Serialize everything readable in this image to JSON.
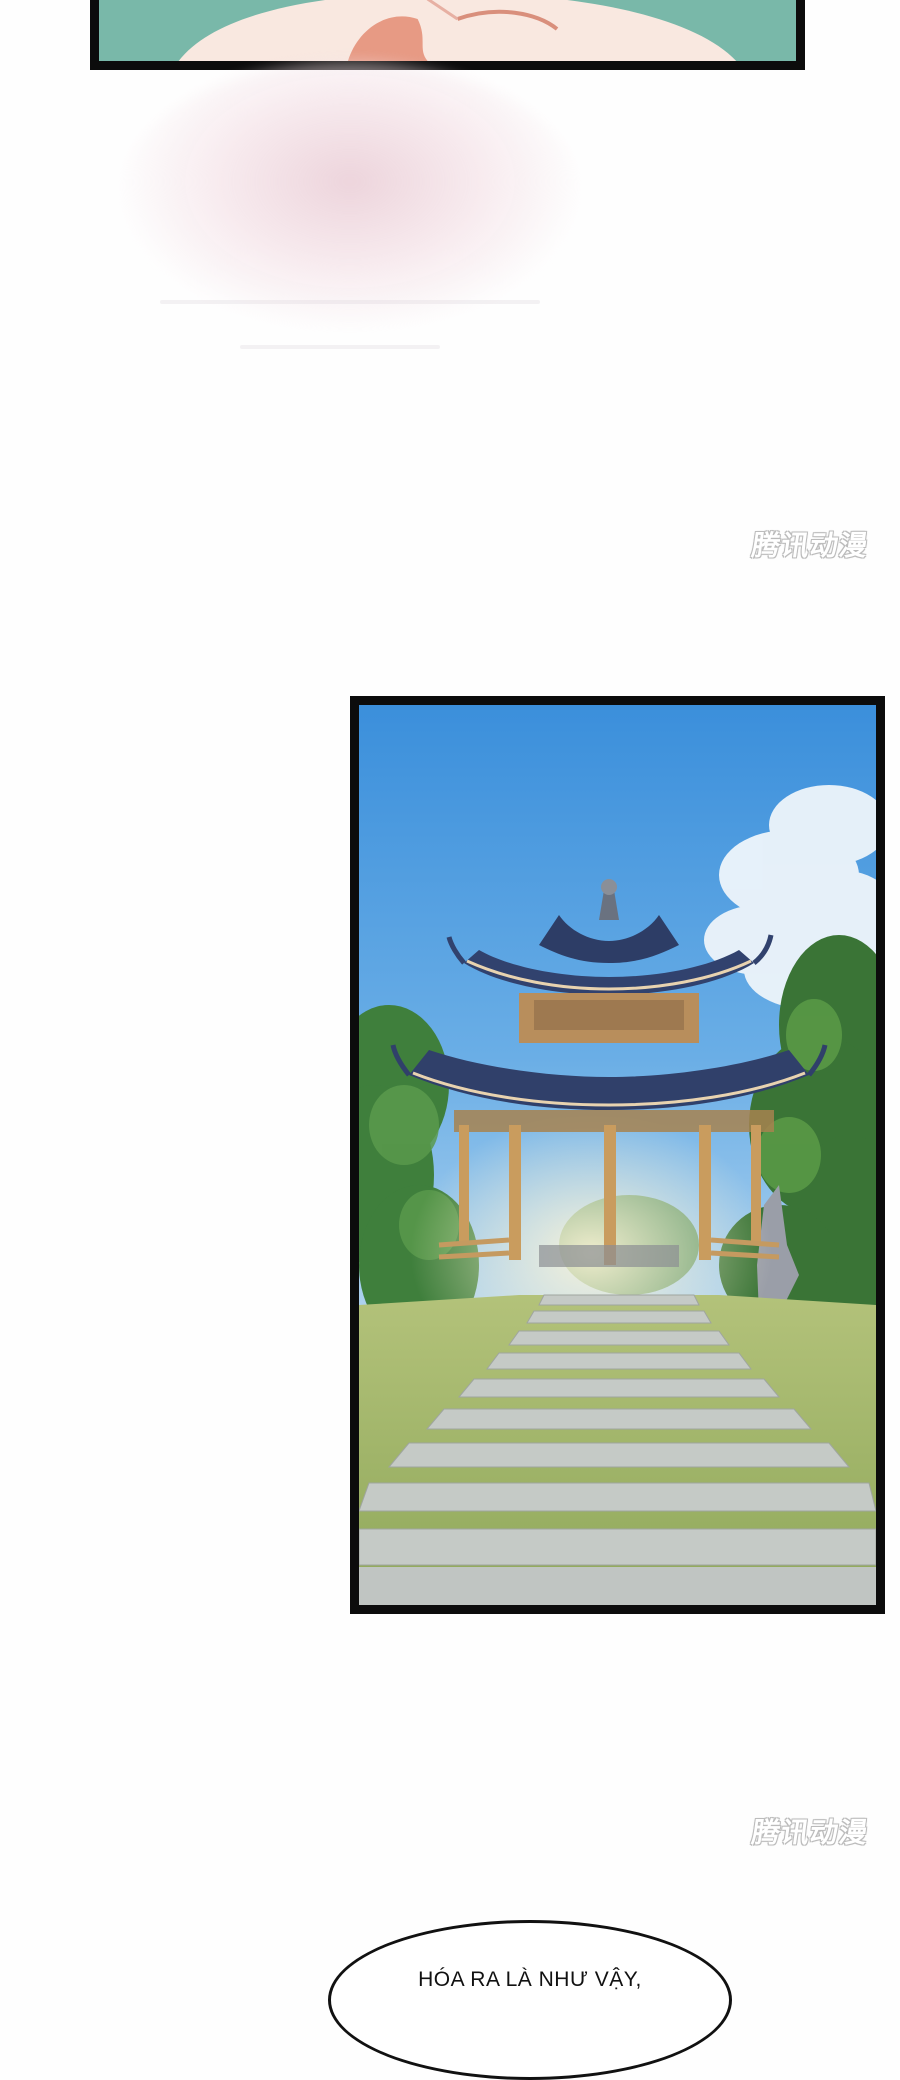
{
  "page": {
    "background": "#fefefe"
  },
  "watermarks": [
    {
      "text": "腾讯动漫"
    },
    {
      "text": "腾讯动漫"
    }
  ],
  "panels": [
    {
      "name": "top-panel-fragment",
      "colors": {
        "background": "#79b8a9",
        "skin": "#f9e8e0",
        "hair": "#e79a84"
      }
    },
    {
      "name": "pagoda-panel",
      "colors": {
        "sky": "#3f92dc",
        "tree": "#3c7a3a",
        "grass": "#9fb76c",
        "stairs": "#c7ccc8",
        "roof": "#2c3e6a",
        "wood": "#c79a5c"
      }
    }
  ],
  "speech_bubble": {
    "text": "HÓA RA LÀ NHƯ VẬY,"
  }
}
